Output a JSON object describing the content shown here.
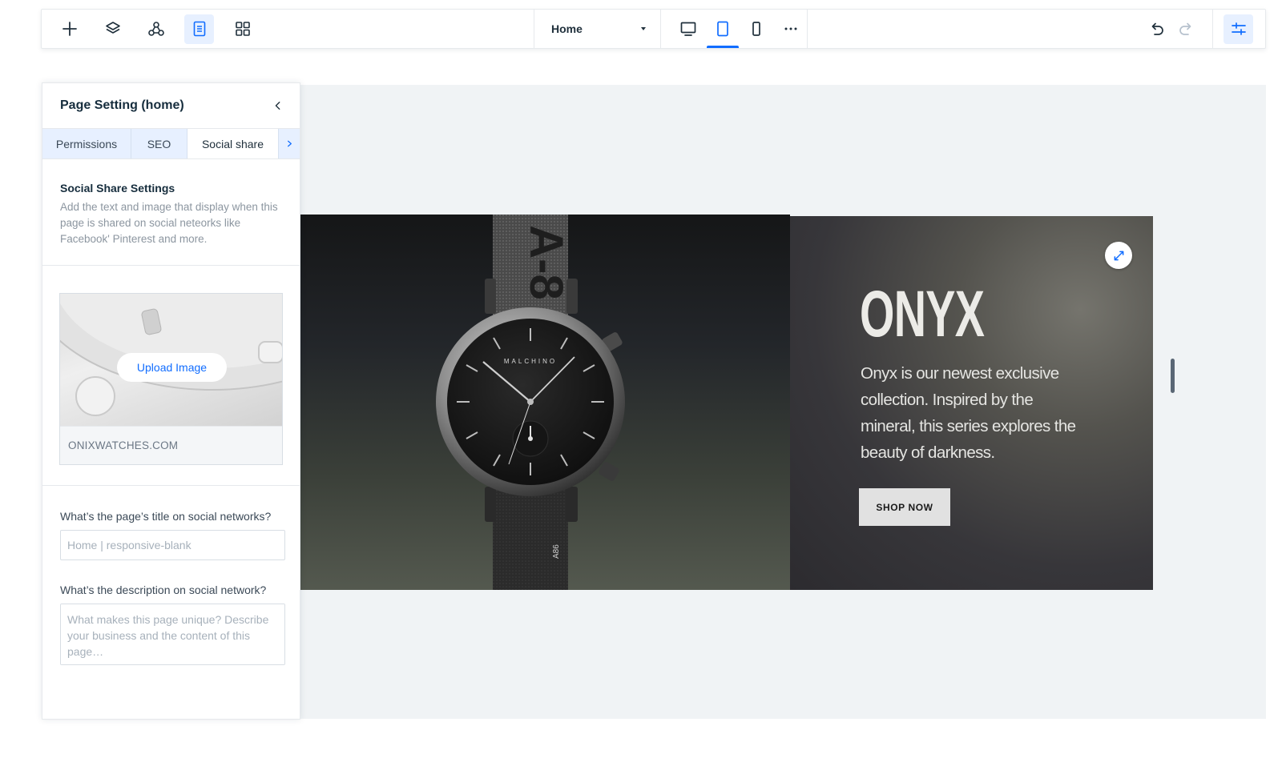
{
  "toolbar": {
    "tools": [
      {
        "icon": "plus-icon",
        "label": "Add"
      },
      {
        "icon": "layers-icon",
        "label": "Layers"
      },
      {
        "icon": "connect-icon",
        "label": "Connect"
      },
      {
        "icon": "pages-icon",
        "label": "Pages"
      },
      {
        "icon": "apps-grid-icon",
        "label": "Apps"
      }
    ],
    "page_select": {
      "value": "Home"
    },
    "devices": [
      {
        "icon": "desktop-icon",
        "label": "Desktop"
      },
      {
        "icon": "tablet-icon",
        "label": "Tablet",
        "active": true
      },
      {
        "icon": "mobile-icon",
        "label": "Mobile"
      }
    ],
    "more_icon": "more-horizontal-icon",
    "undo_icon": "undo-icon",
    "redo_icon": "redo-icon",
    "settings_icon": "sliders-icon"
  },
  "panel": {
    "title": "Page Setting (home)",
    "tabs": [
      "Permissions",
      "SEO",
      "Social share"
    ],
    "active_tab": "Social share",
    "section_title": "Social Share Settings",
    "section_desc": "Add the text and image that display when this page is shared on social neteorks like Facebook' Pinterest and more.",
    "upload_label": "Upload Image",
    "preview_url": "ONIXWATCHES.COM",
    "title_label": "What’s the page’s title on social networks?",
    "title_placeholder": "Home | responsive-blank",
    "desc_label": "What’s the description on social network?",
    "desc_placeholder": "What makes this page unique? Describe your business and the content of this page…"
  },
  "hero": {
    "title": "ONYX",
    "description": "Onyx is our newest exclusive collection. Inspired by the mineral, this series explores the beauty of darkness.",
    "button_label": "SHOP NOW",
    "watch_brand": "MALCHINO",
    "strap_code": "A86",
    "strap_text": "A-8"
  },
  "colors": {
    "accent": "#116dff",
    "accent_light": "#e7f0ff",
    "canvas_bg": "#f0f3f5"
  }
}
